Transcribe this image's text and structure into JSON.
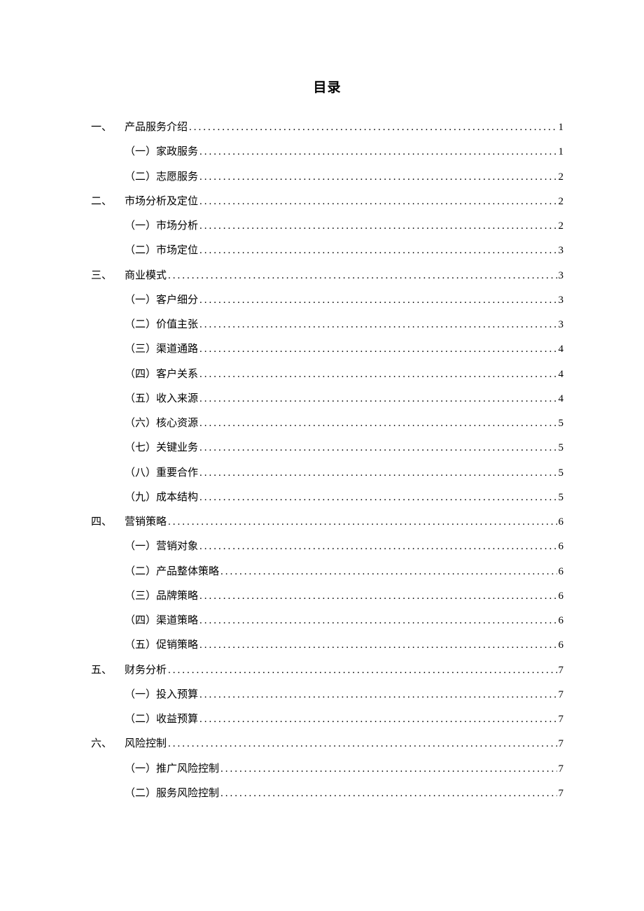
{
  "title": "目录",
  "entries": [
    {
      "level": 1,
      "marker": "一、",
      "label": "产品服务介绍",
      "page": "1"
    },
    {
      "level": 2,
      "marker": "（一）",
      "label": "家政服务",
      "page": "1"
    },
    {
      "level": 2,
      "marker": "（二）",
      "label": "志愿服务",
      "page": "2"
    },
    {
      "level": 1,
      "marker": "二、",
      "label": "市场分析及定位",
      "page": "2"
    },
    {
      "level": 2,
      "marker": "（一）",
      "label": "市场分析",
      "page": "2"
    },
    {
      "level": 2,
      "marker": "（二）",
      "label": "市场定位",
      "page": "3"
    },
    {
      "level": 1,
      "marker": "三、",
      "label": "商业模式",
      "page": "3"
    },
    {
      "level": 2,
      "marker": "（一）",
      "label": "客户细分",
      "page": "3"
    },
    {
      "level": 2,
      "marker": "（二）",
      "label": " 价值主张",
      "page": "3"
    },
    {
      "level": 2,
      "marker": "（三）",
      "label": " 渠道通路",
      "page": "4"
    },
    {
      "level": 2,
      "marker": "（四）",
      "label": " 客户关系",
      "page": "4"
    },
    {
      "level": 2,
      "marker": "（五）",
      "label": " 收入来源",
      "page": "4"
    },
    {
      "level": 2,
      "marker": "（六）",
      "label": " 核心资源",
      "page": "5"
    },
    {
      "level": 2,
      "marker": "（七）",
      "label": " 关键业务",
      "page": "5"
    },
    {
      "level": 2,
      "marker": "（八）",
      "label": " 重要合作",
      "page": "5"
    },
    {
      "level": 2,
      "marker": "（九）",
      "label": " 成本结构",
      "page": "5"
    },
    {
      "level": 1,
      "marker": "四、",
      "label": "营销策略",
      "page": "6"
    },
    {
      "level": 2,
      "marker": "（一）",
      "label": "营销对象",
      "page": "6"
    },
    {
      "level": 2,
      "marker": "（二）",
      "label": "产品整体策略",
      "page": "6"
    },
    {
      "level": 2,
      "marker": "（三）",
      "label": "品牌策略",
      "page": "6"
    },
    {
      "level": 2,
      "marker": "（四）",
      "label": "渠道策略",
      "page": "6"
    },
    {
      "level": 2,
      "marker": "（五）",
      "label": "促销策略",
      "page": "6"
    },
    {
      "level": 1,
      "marker": "五、",
      "label": "财务分析",
      "page": "7"
    },
    {
      "level": 2,
      "marker": "（一）",
      "label": "投入预算",
      "page": "7"
    },
    {
      "level": 2,
      "marker": "（二）",
      "label": "收益预算",
      "page": "7"
    },
    {
      "level": 1,
      "marker": "六、",
      "label": "风险控制",
      "page": "7"
    },
    {
      "level": 2,
      "marker": "（一）",
      "label": "推广风险控制",
      "page": "7"
    },
    {
      "level": 2,
      "marker": "（二）",
      "label": "服务风险控制",
      "page": "7"
    }
  ]
}
